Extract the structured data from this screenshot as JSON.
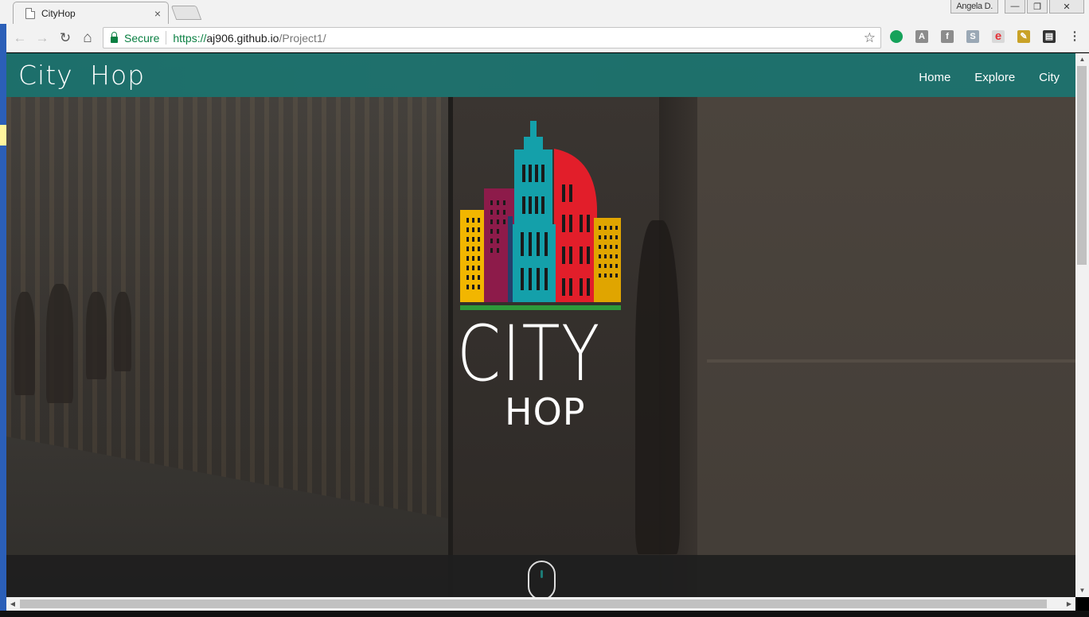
{
  "browser": {
    "tab_title": "CityHop",
    "tab_close": "×",
    "profile_name": "Angela D.",
    "minimize": "—",
    "restore": "❐",
    "close": "✕",
    "back": "←",
    "forward": "→",
    "reload": "↻",
    "home": "⌂",
    "secure_label": "Secure",
    "url_scheme": "https://",
    "url_host": "aj906.github.io",
    "url_path": "/Project1/",
    "star": "☆",
    "extensions": [
      {
        "name": "grammarly",
        "glyph": "",
        "color": "#15a25a"
      },
      {
        "name": "a-icon",
        "glyph": "A",
        "color": "#8c8c8c"
      },
      {
        "name": "f-icon",
        "glyph": "f",
        "color": "#8c8c8c"
      },
      {
        "name": "s-icon",
        "glyph": "S",
        "color": "#9aa8b5"
      },
      {
        "name": "ebay-icon",
        "glyph": "e",
        "color": "#d9d9d9"
      },
      {
        "name": "tools-icon",
        "glyph": "✎",
        "color": "#c9a227"
      },
      {
        "name": "film-icon",
        "glyph": "▤",
        "color": "#333333"
      },
      {
        "name": "menu-icon",
        "glyph": "⋮",
        "color": "#555555"
      }
    ]
  },
  "site": {
    "brand": "City Hop",
    "nav": [
      "Home",
      "Explore",
      "City"
    ],
    "logo_city": "CITY",
    "logo_hop": "HOP",
    "accent_color": "#1c7a75"
  }
}
